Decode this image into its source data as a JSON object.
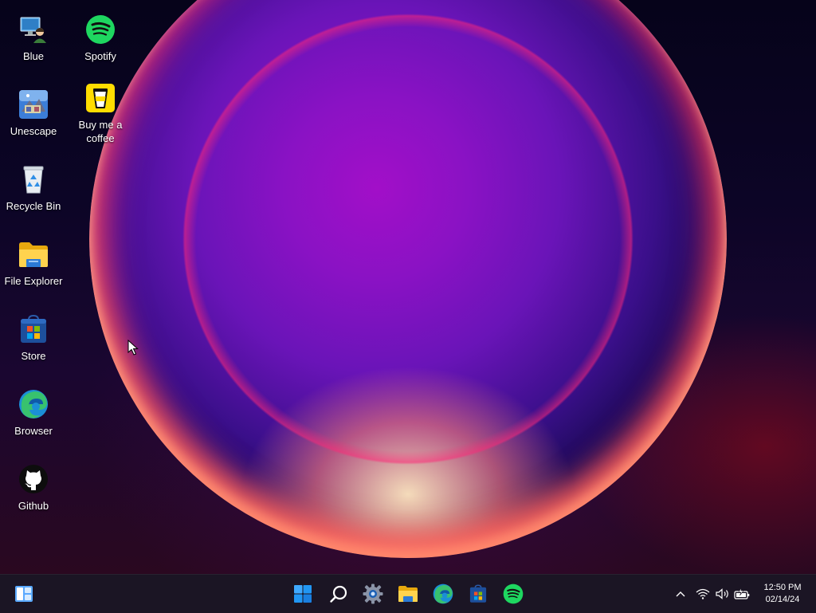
{
  "desktop": {
    "icons": [
      {
        "label": "Blue",
        "icon": "user-computer-icon"
      },
      {
        "label": "Spotify",
        "icon": "spotify-icon"
      },
      {
        "label": "Unescape",
        "icon": "unescape-app-icon"
      },
      {
        "label": "Buy me a coffee",
        "icon": "coffee-cup-icon"
      },
      {
        "label": "Recycle Bin",
        "icon": "recycle-bin-icon"
      },
      {
        "label": "File Explorer",
        "icon": "folder-icon"
      },
      {
        "label": "Store",
        "icon": "store-bag-icon"
      },
      {
        "label": "Browser",
        "icon": "edge-browser-icon"
      },
      {
        "label": "Github",
        "icon": "github-octocat-icon"
      }
    ]
  },
  "taskbar": {
    "left": {
      "icon": "widgets-icon"
    },
    "center": [
      {
        "icon": "windows-start-icon"
      },
      {
        "icon": "search-icon"
      },
      {
        "icon": "settings-gear-icon"
      },
      {
        "icon": "file-explorer-icon"
      },
      {
        "icon": "edge-browser-icon"
      },
      {
        "icon": "store-icon"
      },
      {
        "icon": "spotify-icon"
      }
    ],
    "tray": [
      {
        "icon": "chevron-up-icon"
      },
      {
        "icon": "wifi-icon"
      },
      {
        "icon": "volume-icon"
      },
      {
        "icon": "battery-charging-icon"
      }
    ],
    "clock": {
      "time": "12:50 PM",
      "date": "02/14/24"
    }
  },
  "colors": {
    "taskbar_bg": "#1c1624",
    "spotify_green": "#1ed760",
    "windows_blue": "#1e90ff"
  }
}
